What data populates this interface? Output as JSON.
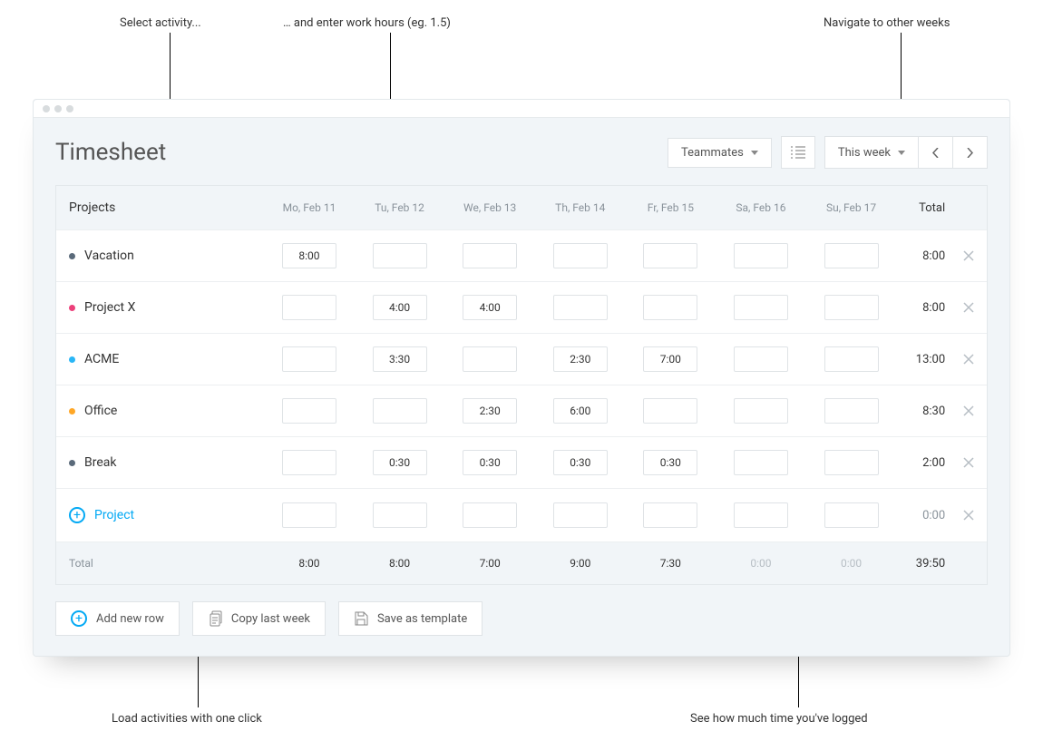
{
  "annotations": {
    "select_activity": "Select activity...",
    "enter_hours": "… and enter work hours (eg. 1.5)",
    "navigate_weeks": "Navigate to other weeks",
    "load_activities": "Load activities with one click",
    "see_time": "See how much time you've logged"
  },
  "header": {
    "title": "Timesheet",
    "teammates_label": "Teammates",
    "week_label": "This week"
  },
  "columns": {
    "projects": "Projects",
    "days": [
      "Mo, Feb 11",
      "Tu, Feb 12",
      "We, Feb 13",
      "Th, Feb 14",
      "Fr, Feb 15",
      "Sa, Feb 16",
      "Su, Feb 17"
    ],
    "total": "Total"
  },
  "rows": [
    {
      "name": "Vacation",
      "color": "#5a6a7a",
      "cells": [
        "8:00",
        "",
        "",
        "",
        "",
        "",
        ""
      ],
      "total": "8:00"
    },
    {
      "name": "Project X",
      "color": "#ec407a",
      "cells": [
        "",
        "4:00",
        "4:00",
        "",
        "",
        "",
        ""
      ],
      "total": "8:00"
    },
    {
      "name": "ACME",
      "color": "#29b6f6",
      "cells": [
        "",
        "3:30",
        "",
        "2:30",
        "7:00",
        "",
        ""
      ],
      "total": "13:00"
    },
    {
      "name": "Office",
      "color": "#ffa726",
      "cells": [
        "",
        "",
        "2:30",
        "6:00",
        "",
        "",
        ""
      ],
      "total": "8:30"
    },
    {
      "name": "Break",
      "color": "#5a6a7a",
      "cells": [
        "",
        "0:30",
        "0:30",
        "0:30",
        "0:30",
        "",
        ""
      ],
      "total": "2:00"
    }
  ],
  "new_row": {
    "label": "Project",
    "total": "0:00"
  },
  "footer": {
    "label": "Total",
    "cells": [
      "8:00",
      "8:00",
      "7:00",
      "9:00",
      "7:30",
      "0:00",
      "0:00"
    ],
    "grand": "39:50"
  },
  "actions": {
    "add": "Add new row",
    "copy": "Copy last week",
    "save": "Save as template"
  }
}
